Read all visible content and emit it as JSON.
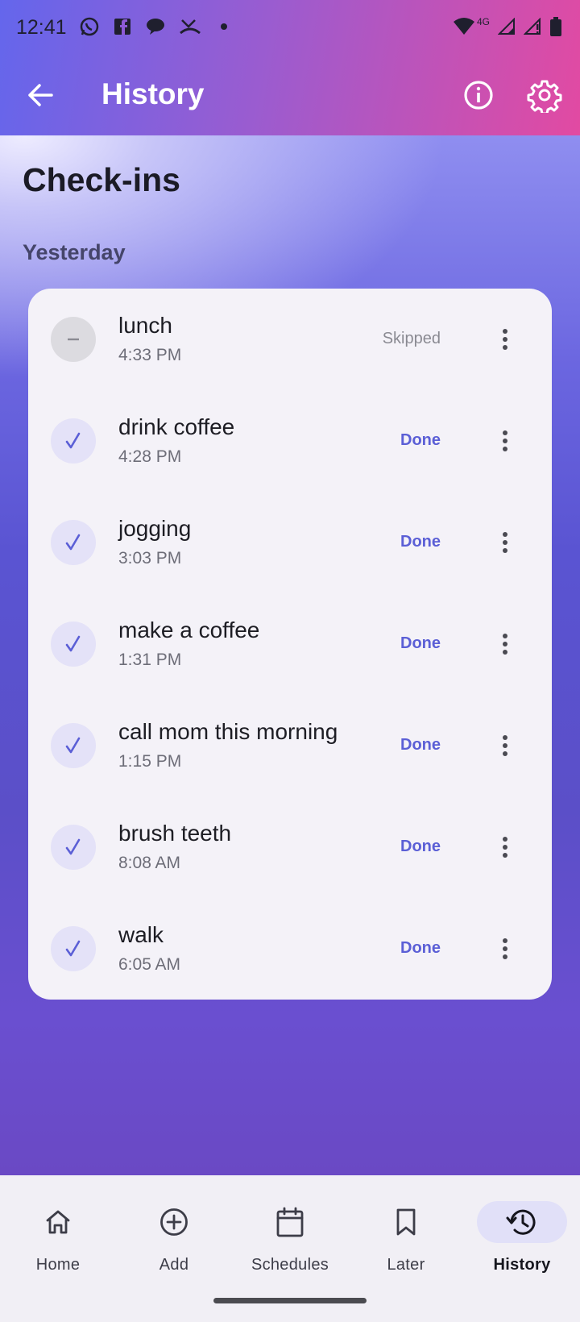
{
  "status_bar": {
    "time": "12:41",
    "left_icons": [
      "whatsapp-icon",
      "facebook-icon",
      "chat-bubble-icon",
      "missed-call-icon",
      "dot-icon"
    ],
    "right_icons": [
      "wifi-icon",
      "signal-4g-icon",
      "signal-icon",
      "signal-alert-icon",
      "battery-icon"
    ],
    "network_label": "4G"
  },
  "app_bar": {
    "title": "History",
    "back_icon": "arrow-back-icon",
    "info_icon": "info-icon",
    "settings_icon": "gear-icon"
  },
  "page": {
    "title": "Check-ins",
    "section_label": "Yesterday"
  },
  "checkins": [
    {
      "title": "lunch",
      "time": "4:33 PM",
      "status": "Skipped",
      "state": "skipped"
    },
    {
      "title": "drink coffee",
      "time": "4:28 PM",
      "status": "Done",
      "state": "done"
    },
    {
      "title": "jogging",
      "time": "3:03 PM",
      "status": "Done",
      "state": "done"
    },
    {
      "title": "make a coffee",
      "time": "1:31 PM",
      "status": "Done",
      "state": "done"
    },
    {
      "title": "call mom this morning",
      "time": "1:15 PM",
      "status": "Done",
      "state": "done"
    },
    {
      "title": "brush teeth",
      "time": "8:08 AM",
      "status": "Done",
      "state": "done"
    },
    {
      "title": "walk",
      "time": "6:05 AM",
      "status": "Done",
      "state": "done"
    }
  ],
  "bottom_nav": [
    {
      "label": "Home",
      "icon": "home-icon",
      "active": false
    },
    {
      "label": "Add",
      "icon": "add-circle-icon",
      "active": false
    },
    {
      "label": "Schedules",
      "icon": "calendar-icon",
      "active": false
    },
    {
      "label": "Later",
      "icon": "bookmark-icon",
      "active": false
    },
    {
      "label": "History",
      "icon": "history-icon",
      "active": true
    }
  ],
  "colors": {
    "accent": "#5b5fd6",
    "header_gradient_start": "#6466ec",
    "header_gradient_end": "#e24aa2",
    "card_background": "#f4f2f8",
    "nav_active_pill": "#e1e0f8"
  }
}
